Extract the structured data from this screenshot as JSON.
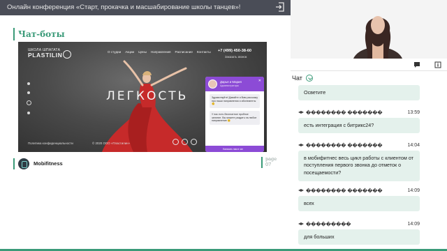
{
  "topbar": {
    "title": "Онлайн конференция «Старт, прокачка и масшабирование школы танцев»!",
    "exit_icon": "exit-icon"
  },
  "slide": {
    "title": "Чат-боты",
    "company": "Mobifitness",
    "page_label": "page",
    "page_number": "07"
  },
  "website": {
    "logo_line1": "ШКОЛА ШПАГАТА",
    "logo_line2": "PLASTILIN",
    "nav": [
      "О студии",
      "Акции",
      "Цены",
      "Направления",
      "Расписание",
      "Контакты"
    ],
    "phone": "+7 (499) 450-38-60",
    "callback": "Заказать звонок",
    "hero": "ЛЕГКОСТЬ",
    "privacy": "Политика конфиденциальности",
    "copyright": "© 2020 ООО «Пластилин»"
  },
  "widget": {
    "name": "Дарья и Мария",
    "subtitle": "Администраторы",
    "message1": "Здравствуйте! Давайте я Вам расскажу про наши направления и абонементы 😊",
    "message2": "У нас есть бесплатное пробное занятие. Вы можете раздать на любое направление 😊",
    "footer": "Написать нам в чат"
  },
  "chat": {
    "label": "Чат",
    "messages": [
      {
        "author": "",
        "time": "",
        "text": "Осветите"
      },
      {
        "author": "�������� �������",
        "time": "13:59",
        "text": "есть интеграция с битрикс24?"
      },
      {
        "author": "�������� �������",
        "time": "14:04",
        "text": "в мобифитнес весь цикл работы с клиентом от поступления первого звонка до отметок о посещаемости?"
      },
      {
        "author": "�������� �������",
        "time": "14:09",
        "text": "всех"
      },
      {
        "author": "���������",
        "time": "14:09",
        "text": "для больших"
      }
    ]
  },
  "colors": {
    "accent": "#3a9a78",
    "topbar": "#4a4d57",
    "bubble": "#e4f1ec",
    "widget": "#8c4bd6"
  }
}
